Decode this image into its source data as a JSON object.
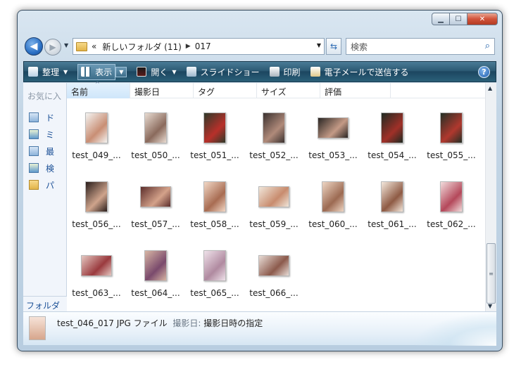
{
  "window": {
    "caption_buttons": [
      "minimize",
      "maximize",
      "close"
    ]
  },
  "address_bar": {
    "chevron": "«",
    "path": [
      "新しいフォルダ (11)",
      "017"
    ]
  },
  "search": {
    "placeholder": "検索"
  },
  "toolbar": {
    "organize": "整理",
    "views": "表示",
    "open": "開く",
    "slideshow": "スライドショー",
    "print": "印刷",
    "email": "電子メールで送信する",
    "help": "?"
  },
  "nav_pane": {
    "favorites_header": "お気に入",
    "items": [
      "ド",
      "ミ",
      "最",
      "検",
      "パ"
    ],
    "folders_label": "フォルダ"
  },
  "columns": [
    "名前",
    "撮影日",
    "タグ",
    "サイズ",
    "評価"
  ],
  "files": [
    {
      "name": "test_049_...",
      "orient": "p",
      "colors": [
        "#f4f4f2",
        "#c98e74"
      ]
    },
    {
      "name": "test_050_...",
      "orient": "p",
      "colors": [
        "#e9dcd2",
        "#8a6a5c"
      ]
    },
    {
      "name": "test_051_...",
      "orient": "p",
      "colors": [
        "#2e3a2a",
        "#b8302a"
      ]
    },
    {
      "name": "test_052_...",
      "orient": "p",
      "colors": [
        "#3b3230",
        "#b08a7a"
      ]
    },
    {
      "name": "test_053_...",
      "orient": "l",
      "colors": [
        "#2a2624",
        "#c49a86"
      ]
    },
    {
      "name": "test_054_...",
      "orient": "p",
      "colors": [
        "#1e2a22",
        "#a03028"
      ]
    },
    {
      "name": "test_055_...",
      "orient": "p",
      "colors": [
        "#233026",
        "#b0382e"
      ]
    },
    {
      "name": "test_056_...",
      "orient": "p",
      "colors": [
        "#2a1e1c",
        "#cfa48c"
      ]
    },
    {
      "name": "test_057_...",
      "orient": "l",
      "colors": [
        "#5c2e2c",
        "#d4a28a"
      ]
    },
    {
      "name": "test_058_...",
      "orient": "p",
      "colors": [
        "#f2d8c6",
        "#a86c52"
      ]
    },
    {
      "name": "test_059_...",
      "orient": "l",
      "colors": [
        "#f0e6da",
        "#c88c6e"
      ]
    },
    {
      "name": "test_060_...",
      "orient": "p",
      "colors": [
        "#eed6c4",
        "#9c6a52"
      ]
    },
    {
      "name": "test_061_...",
      "orient": "p",
      "colors": [
        "#f4e8dc",
        "#8e5a44"
      ]
    },
    {
      "name": "test_062_...",
      "orient": "p",
      "colors": [
        "#f2dcdc",
        "#b4485a"
      ]
    },
    {
      "name": "test_063_...",
      "orient": "l",
      "colors": [
        "#e4c6c0",
        "#9a3a3e"
      ]
    },
    {
      "name": "test_064_...",
      "orient": "p",
      "colors": [
        "#d8b6a4",
        "#7a4a6c"
      ]
    },
    {
      "name": "test_065_...",
      "orient": "p",
      "colors": [
        "#efe2ea",
        "#b08aa0"
      ]
    },
    {
      "name": "test_066_...",
      "orient": "l",
      "colors": [
        "#e8dcd6",
        "#8c5a4c"
      ]
    }
  ],
  "details": {
    "file": "test_046_017",
    "type": "JPG ファイル",
    "date_label": "撮影日:",
    "date_value": "撮影日時の指定"
  }
}
